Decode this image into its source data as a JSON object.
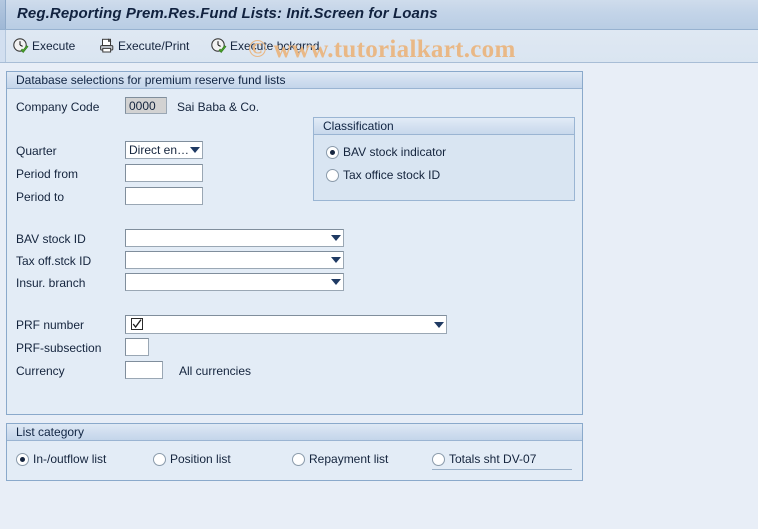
{
  "window": {
    "title": "Reg.Reporting Prem.Res.Fund Lists: Init.Screen for Loans"
  },
  "watermark": {
    "text": "© www.tutorialkart.com",
    "color": "#e9b886"
  },
  "toolbar": {
    "buttons": [
      {
        "label": "Execute",
        "icon": "execute-clock-check-icon"
      },
      {
        "label": "Execute/Print",
        "icon": "printer-icon"
      },
      {
        "label": "Execute bckgrnd",
        "icon": "execute-background-clock-check-icon"
      }
    ]
  },
  "database_selections": {
    "title": "Database selections for premium reserve fund lists",
    "company_code": {
      "label": "Company Code",
      "value": "0000",
      "description": "Sai Baba & Co."
    },
    "quarter": {
      "label": "Quarter",
      "value": "Direct en…"
    },
    "period_from": {
      "label": "Period from",
      "value": "",
      "placeholder": ""
    },
    "period_to": {
      "label": "Period to",
      "value": "",
      "placeholder": ""
    },
    "bav_stock_id": {
      "label": "BAV stock ID",
      "value": ""
    },
    "tax_off_stck_id": {
      "label": "Tax off.stck ID",
      "value": ""
    },
    "insur_branch": {
      "label": "Insur. branch",
      "value": ""
    },
    "prf_number": {
      "label": "PRF number",
      "value": "",
      "icon": "checked-checkbox-icon"
    },
    "prf_subsection": {
      "label": "PRF-subsection",
      "value": ""
    },
    "currency": {
      "label": "Currency",
      "value": "",
      "note": "All currencies"
    }
  },
  "classification": {
    "title": "Classification",
    "options": [
      {
        "label": "BAV stock indicator",
        "selected": true
      },
      {
        "label": "Tax office stock ID",
        "selected": false
      }
    ]
  },
  "list_category": {
    "title": "List category",
    "options": [
      {
        "label": "In-/outflow list",
        "selected": true
      },
      {
        "label": "Position list",
        "selected": false
      },
      {
        "label": "Repayment list",
        "selected": false
      },
      {
        "label": "Totals sht DV-07",
        "selected": false
      }
    ]
  },
  "colors": {
    "background": "#e8eef7",
    "panel": "#e3ecf6",
    "panel_border": "#8aa9cb",
    "title_text": "#11223f",
    "accent": "#c3d4e8"
  }
}
